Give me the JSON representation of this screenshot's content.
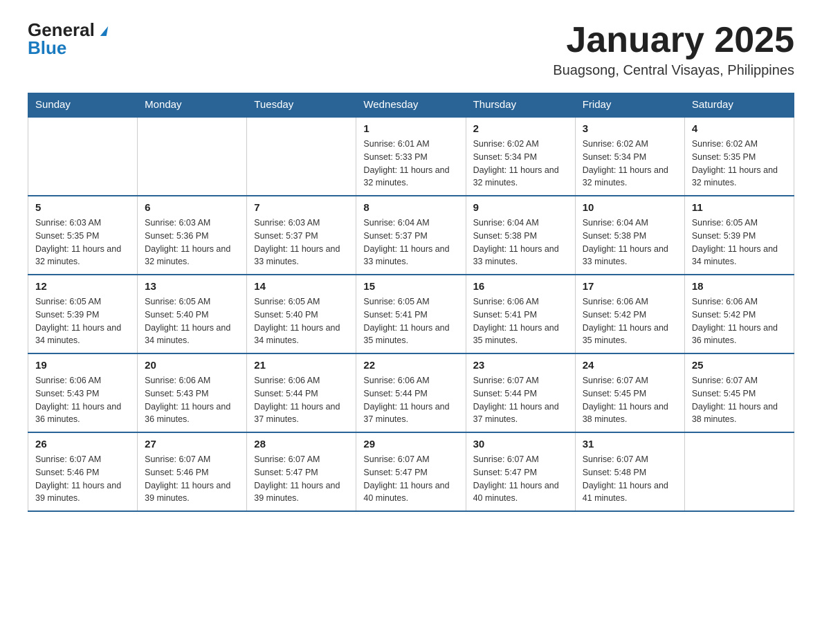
{
  "header": {
    "logo": {
      "general": "General",
      "blue": "Blue"
    },
    "title": "January 2025",
    "location": "Buagsong, Central Visayas, Philippines"
  },
  "weekdays": [
    "Sunday",
    "Monday",
    "Tuesday",
    "Wednesday",
    "Thursday",
    "Friday",
    "Saturday"
  ],
  "weeks": [
    [
      {
        "day": "",
        "sunrise": "",
        "sunset": "",
        "daylight": ""
      },
      {
        "day": "",
        "sunrise": "",
        "sunset": "",
        "daylight": ""
      },
      {
        "day": "",
        "sunrise": "",
        "sunset": "",
        "daylight": ""
      },
      {
        "day": "1",
        "sunrise": "Sunrise: 6:01 AM",
        "sunset": "Sunset: 5:33 PM",
        "daylight": "Daylight: 11 hours and 32 minutes."
      },
      {
        "day": "2",
        "sunrise": "Sunrise: 6:02 AM",
        "sunset": "Sunset: 5:34 PM",
        "daylight": "Daylight: 11 hours and 32 minutes."
      },
      {
        "day": "3",
        "sunrise": "Sunrise: 6:02 AM",
        "sunset": "Sunset: 5:34 PM",
        "daylight": "Daylight: 11 hours and 32 minutes."
      },
      {
        "day": "4",
        "sunrise": "Sunrise: 6:02 AM",
        "sunset": "Sunset: 5:35 PM",
        "daylight": "Daylight: 11 hours and 32 minutes."
      }
    ],
    [
      {
        "day": "5",
        "sunrise": "Sunrise: 6:03 AM",
        "sunset": "Sunset: 5:35 PM",
        "daylight": "Daylight: 11 hours and 32 minutes."
      },
      {
        "day": "6",
        "sunrise": "Sunrise: 6:03 AM",
        "sunset": "Sunset: 5:36 PM",
        "daylight": "Daylight: 11 hours and 32 minutes."
      },
      {
        "day": "7",
        "sunrise": "Sunrise: 6:03 AM",
        "sunset": "Sunset: 5:37 PM",
        "daylight": "Daylight: 11 hours and 33 minutes."
      },
      {
        "day": "8",
        "sunrise": "Sunrise: 6:04 AM",
        "sunset": "Sunset: 5:37 PM",
        "daylight": "Daylight: 11 hours and 33 minutes."
      },
      {
        "day": "9",
        "sunrise": "Sunrise: 6:04 AM",
        "sunset": "Sunset: 5:38 PM",
        "daylight": "Daylight: 11 hours and 33 minutes."
      },
      {
        "day": "10",
        "sunrise": "Sunrise: 6:04 AM",
        "sunset": "Sunset: 5:38 PM",
        "daylight": "Daylight: 11 hours and 33 minutes."
      },
      {
        "day": "11",
        "sunrise": "Sunrise: 6:05 AM",
        "sunset": "Sunset: 5:39 PM",
        "daylight": "Daylight: 11 hours and 34 minutes."
      }
    ],
    [
      {
        "day": "12",
        "sunrise": "Sunrise: 6:05 AM",
        "sunset": "Sunset: 5:39 PM",
        "daylight": "Daylight: 11 hours and 34 minutes."
      },
      {
        "day": "13",
        "sunrise": "Sunrise: 6:05 AM",
        "sunset": "Sunset: 5:40 PM",
        "daylight": "Daylight: 11 hours and 34 minutes."
      },
      {
        "day": "14",
        "sunrise": "Sunrise: 6:05 AM",
        "sunset": "Sunset: 5:40 PM",
        "daylight": "Daylight: 11 hours and 34 minutes."
      },
      {
        "day": "15",
        "sunrise": "Sunrise: 6:05 AM",
        "sunset": "Sunset: 5:41 PM",
        "daylight": "Daylight: 11 hours and 35 minutes."
      },
      {
        "day": "16",
        "sunrise": "Sunrise: 6:06 AM",
        "sunset": "Sunset: 5:41 PM",
        "daylight": "Daylight: 11 hours and 35 minutes."
      },
      {
        "day": "17",
        "sunrise": "Sunrise: 6:06 AM",
        "sunset": "Sunset: 5:42 PM",
        "daylight": "Daylight: 11 hours and 35 minutes."
      },
      {
        "day": "18",
        "sunrise": "Sunrise: 6:06 AM",
        "sunset": "Sunset: 5:42 PM",
        "daylight": "Daylight: 11 hours and 36 minutes."
      }
    ],
    [
      {
        "day": "19",
        "sunrise": "Sunrise: 6:06 AM",
        "sunset": "Sunset: 5:43 PM",
        "daylight": "Daylight: 11 hours and 36 minutes."
      },
      {
        "day": "20",
        "sunrise": "Sunrise: 6:06 AM",
        "sunset": "Sunset: 5:43 PM",
        "daylight": "Daylight: 11 hours and 36 minutes."
      },
      {
        "day": "21",
        "sunrise": "Sunrise: 6:06 AM",
        "sunset": "Sunset: 5:44 PM",
        "daylight": "Daylight: 11 hours and 37 minutes."
      },
      {
        "day": "22",
        "sunrise": "Sunrise: 6:06 AM",
        "sunset": "Sunset: 5:44 PM",
        "daylight": "Daylight: 11 hours and 37 minutes."
      },
      {
        "day": "23",
        "sunrise": "Sunrise: 6:07 AM",
        "sunset": "Sunset: 5:44 PM",
        "daylight": "Daylight: 11 hours and 37 minutes."
      },
      {
        "day": "24",
        "sunrise": "Sunrise: 6:07 AM",
        "sunset": "Sunset: 5:45 PM",
        "daylight": "Daylight: 11 hours and 38 minutes."
      },
      {
        "day": "25",
        "sunrise": "Sunrise: 6:07 AM",
        "sunset": "Sunset: 5:45 PM",
        "daylight": "Daylight: 11 hours and 38 minutes."
      }
    ],
    [
      {
        "day": "26",
        "sunrise": "Sunrise: 6:07 AM",
        "sunset": "Sunset: 5:46 PM",
        "daylight": "Daylight: 11 hours and 39 minutes."
      },
      {
        "day": "27",
        "sunrise": "Sunrise: 6:07 AM",
        "sunset": "Sunset: 5:46 PM",
        "daylight": "Daylight: 11 hours and 39 minutes."
      },
      {
        "day": "28",
        "sunrise": "Sunrise: 6:07 AM",
        "sunset": "Sunset: 5:47 PM",
        "daylight": "Daylight: 11 hours and 39 minutes."
      },
      {
        "day": "29",
        "sunrise": "Sunrise: 6:07 AM",
        "sunset": "Sunset: 5:47 PM",
        "daylight": "Daylight: 11 hours and 40 minutes."
      },
      {
        "day": "30",
        "sunrise": "Sunrise: 6:07 AM",
        "sunset": "Sunset: 5:47 PM",
        "daylight": "Daylight: 11 hours and 40 minutes."
      },
      {
        "day": "31",
        "sunrise": "Sunrise: 6:07 AM",
        "sunset": "Sunset: 5:48 PM",
        "daylight": "Daylight: 11 hours and 41 minutes."
      },
      {
        "day": "",
        "sunrise": "",
        "sunset": "",
        "daylight": ""
      }
    ]
  ]
}
